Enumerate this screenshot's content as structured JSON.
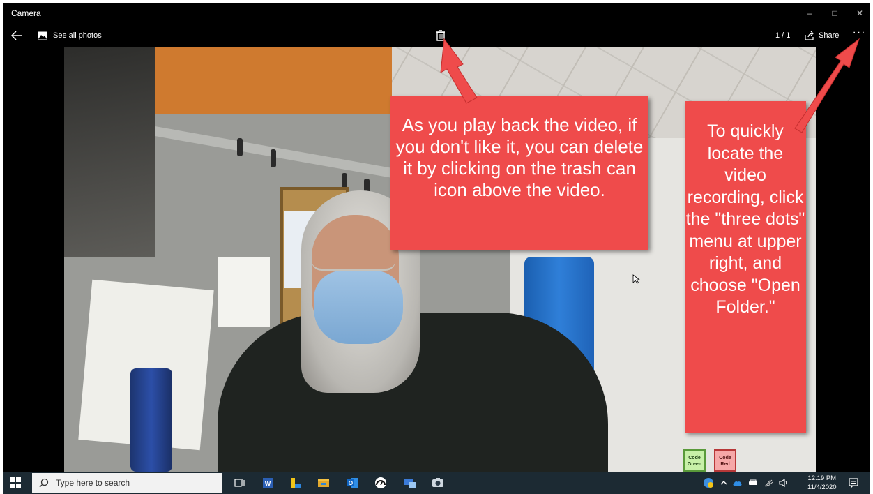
{
  "window": {
    "title": "Camera",
    "controls": {
      "minimize": "–",
      "maximize": "□",
      "close": "✕"
    }
  },
  "commandbar": {
    "see_all_photos": "See all photos",
    "counter": "1 / 1",
    "share_label": "Share",
    "more": "···"
  },
  "icons": {
    "back": "back-arrow-icon",
    "photos": "photos-icon",
    "trash": "trash-icon",
    "share": "share-icon",
    "more": "more-options-icon"
  },
  "video": {
    "sign_green": "Code Green",
    "sign_red": "Code Red"
  },
  "callouts": {
    "trash_text": "As you play back the video, if you don't like it, you can delete it by clicking on the trash can icon above the video.",
    "dots_text": "To quickly locate the video recording, click the \"three dots\" menu at upper right, and choose \"Open Folder.\""
  },
  "taskbar": {
    "search_placeholder": "Type here to search",
    "time": "12:19 PM",
    "date": "11/4/2020"
  },
  "colors": {
    "callout": "#ef4b4b",
    "taskbar": "#1c2a33",
    "chrome": "#000000"
  }
}
